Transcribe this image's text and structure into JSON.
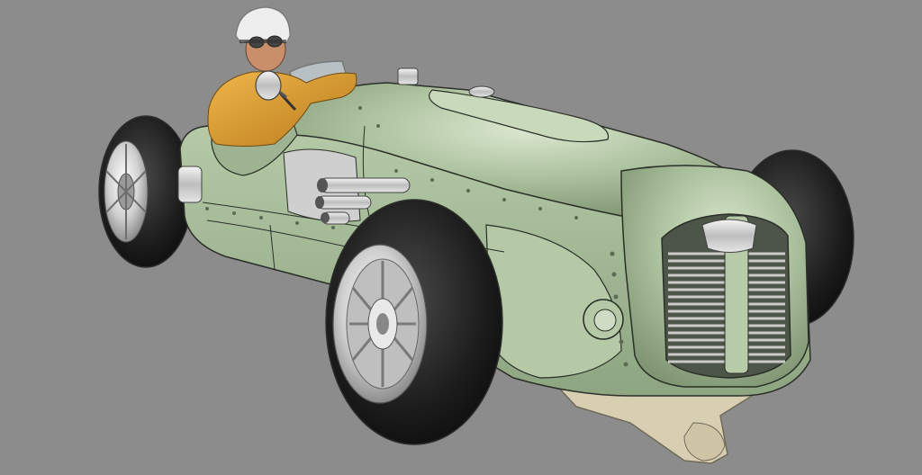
{
  "viewport": {
    "background": "#8c8c8c"
  },
  "palette": {
    "body_paint": "#a9bf9b",
    "body_highlight": "#dbe8d0",
    "body_shadow": "#7f9573",
    "tire": "#1c1c1c",
    "tire_highlight": "#4a4a4a",
    "rim": "#d9d9d9",
    "rim_shadow": "#8d8d8d",
    "chrome": "#e6e6e6",
    "skid_plate": "#d8cfb3",
    "driver_jacket": "#d89a2e",
    "driver_skin": "#c88f6a",
    "helmet": "#eeeeee",
    "outline": "#2a2f28"
  }
}
